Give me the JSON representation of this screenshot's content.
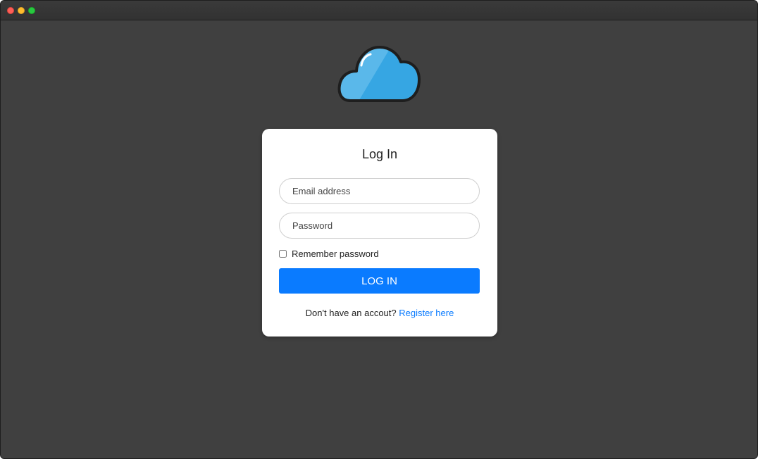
{
  "window": {
    "traffic_lights": {
      "close_color": "#fe5f57",
      "minimize_color": "#febc2e",
      "zoom_color": "#28c840"
    },
    "background_color": "#404040"
  },
  "logo": {
    "icon": "cloud-icon",
    "colors": {
      "light": "#5ab8ea",
      "dark": "#36a6e3",
      "outline": "#1e1e1e"
    }
  },
  "login": {
    "title": "Log In",
    "email_placeholder": "Email address",
    "password_placeholder": "Password",
    "remember_label": "Remember password",
    "remember_checked": false,
    "submit_label": "LOG IN",
    "register_prompt": "Don't have an accout?",
    "register_link": "Register here",
    "accent_color": "#0a7bff"
  }
}
